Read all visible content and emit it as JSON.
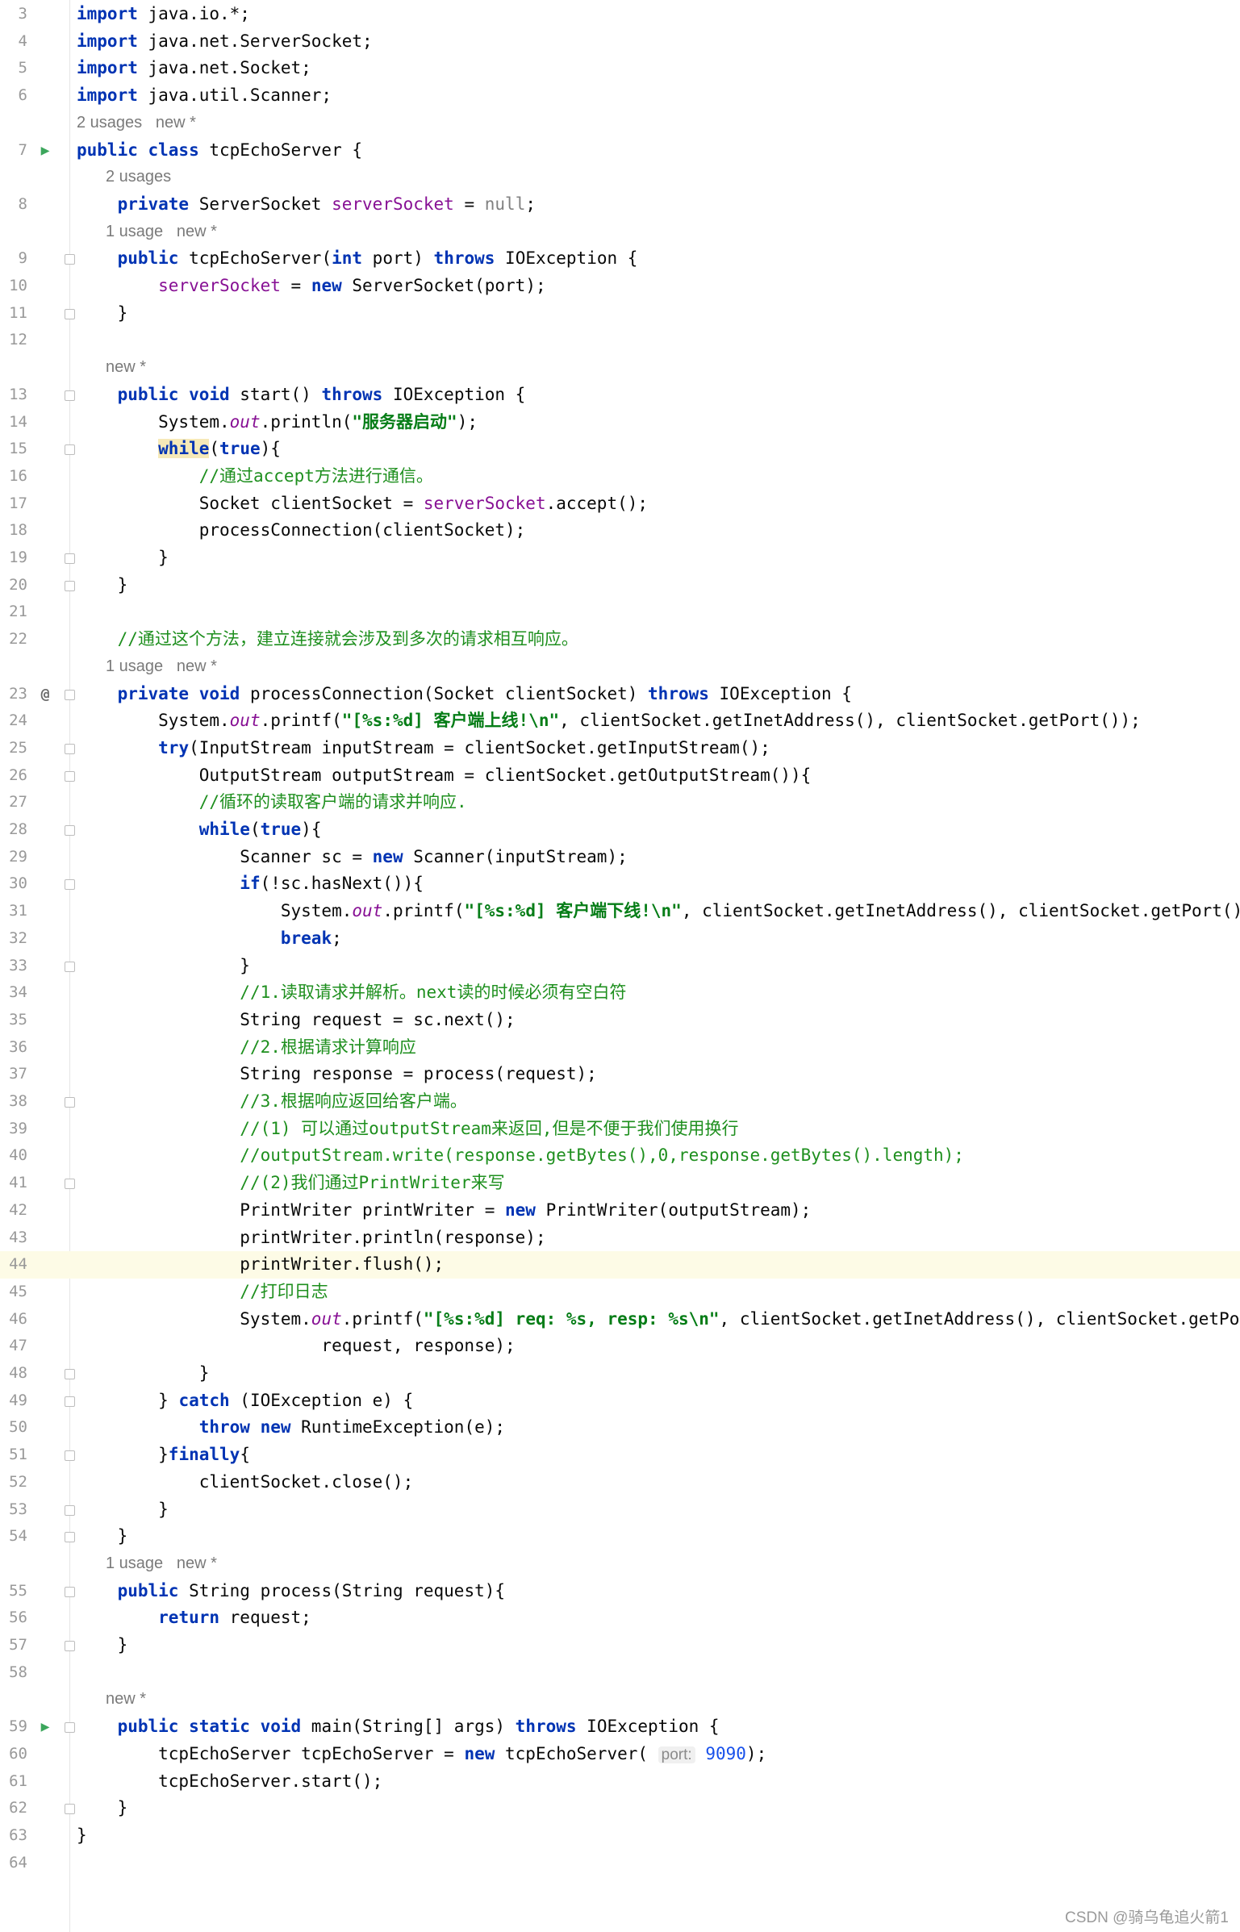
{
  "editor": {
    "lines": [
      {
        "n": "3",
        "parts": [
          [
            "k",
            "import"
          ],
          [
            "t",
            " java.io.*;"
          ]
        ]
      },
      {
        "n": "4",
        "parts": [
          [
            "k",
            "import"
          ],
          [
            "t",
            " java.net.ServerSocket;"
          ]
        ]
      },
      {
        "n": "5",
        "parts": [
          [
            "k",
            "import"
          ],
          [
            "t",
            " java.net.Socket;"
          ]
        ]
      },
      {
        "n": "6",
        "parts": [
          [
            "k",
            "import"
          ],
          [
            "t",
            " java.util.Scanner;"
          ]
        ]
      },
      {
        "meta": "2 usages   new *",
        "ind": 0
      },
      {
        "n": "7",
        "icon": "run",
        "parts": [
          [
            "k",
            "public class"
          ],
          [
            "t",
            " tcpEchoServer {"
          ]
        ]
      },
      {
        "meta": "2 usages",
        "ind": 1
      },
      {
        "n": "8",
        "parts": [
          [
            "t",
            "    "
          ],
          [
            "k",
            "private"
          ],
          [
            "t",
            " ServerSocket "
          ],
          [
            "f",
            "serverSocket"
          ],
          [
            "t",
            " = "
          ],
          [
            "nul",
            "null"
          ],
          [
            "t",
            ";"
          ]
        ]
      },
      {
        "meta": "1 usage   new *",
        "ind": 1
      },
      {
        "n": "9",
        "parts": [
          [
            "t",
            "    "
          ],
          [
            "k",
            "public"
          ],
          [
            "t",
            " tcpEchoServer("
          ],
          [
            "k",
            "int"
          ],
          [
            "t",
            " port) "
          ],
          [
            "k",
            "throws"
          ],
          [
            "t",
            " IOException {"
          ]
        ]
      },
      {
        "n": "10",
        "parts": [
          [
            "t",
            "        "
          ],
          [
            "f",
            "serverSocket"
          ],
          [
            "t",
            " = "
          ],
          [
            "k",
            "new"
          ],
          [
            "t",
            " ServerSocket(port);"
          ]
        ]
      },
      {
        "n": "11",
        "parts": [
          [
            "t",
            "    }"
          ]
        ]
      },
      {
        "n": "12",
        "parts": []
      },
      {
        "meta": "new *",
        "ind": 1
      },
      {
        "n": "13",
        "parts": [
          [
            "t",
            "    "
          ],
          [
            "k",
            "public void"
          ],
          [
            "t",
            " start() "
          ],
          [
            "k",
            "throws"
          ],
          [
            "t",
            " IOException {"
          ]
        ]
      },
      {
        "n": "14",
        "parts": [
          [
            "t",
            "        System."
          ],
          [
            "st",
            "out"
          ],
          [
            "t",
            ".println("
          ],
          [
            "s",
            "\"服务器启动\""
          ],
          [
            "t",
            ");"
          ]
        ]
      },
      {
        "n": "15",
        "parts": [
          [
            "t",
            "        "
          ],
          [
            "kw",
            "while"
          ],
          [
            "t",
            "("
          ],
          [
            "k",
            "true"
          ],
          [
            "t",
            "){"
          ]
        ]
      },
      {
        "n": "16",
        "parts": [
          [
            "t",
            "            "
          ],
          [
            "c",
            "//通过accept方法进行通信。"
          ]
        ]
      },
      {
        "n": "17",
        "parts": [
          [
            "t",
            "            Socket clientSocket = "
          ],
          [
            "f",
            "serverSocket"
          ],
          [
            "t",
            ".accept();"
          ]
        ]
      },
      {
        "n": "18",
        "parts": [
          [
            "t",
            "            processConnection(clientSocket);"
          ]
        ]
      },
      {
        "n": "19",
        "parts": [
          [
            "t",
            "        }"
          ]
        ]
      },
      {
        "n": "20",
        "parts": [
          [
            "t",
            "    }"
          ]
        ]
      },
      {
        "n": "21",
        "parts": []
      },
      {
        "n": "22",
        "parts": [
          [
            "t",
            "    "
          ],
          [
            "c",
            "//通过这个方法，建立连接就会涉及到多次的请求相互响应。"
          ]
        ]
      },
      {
        "meta": "1 usage   new *",
        "ind": 1
      },
      {
        "n": "23",
        "icon": "at",
        "parts": [
          [
            "t",
            "    "
          ],
          [
            "k",
            "private void"
          ],
          [
            "t",
            " processConnection(Socket clientSocket) "
          ],
          [
            "k",
            "throws"
          ],
          [
            "t",
            " IOException {"
          ]
        ]
      },
      {
        "n": "24",
        "parts": [
          [
            "t",
            "        System."
          ],
          [
            "st",
            "out"
          ],
          [
            "t",
            ".printf("
          ],
          [
            "s",
            "\"[%s:%d] 客户端上线!\\n\""
          ],
          [
            "t",
            ", clientSocket.getInetAddress(), clientSocket.getPort());"
          ]
        ]
      },
      {
        "n": "25",
        "parts": [
          [
            "t",
            "        "
          ],
          [
            "k",
            "try"
          ],
          [
            "t",
            "(InputStream inputStream = clientSocket.getInputStream();"
          ]
        ]
      },
      {
        "n": "26",
        "parts": [
          [
            "t",
            "            OutputStream outputStream = clientSocket.getOutputStream()){"
          ]
        ]
      },
      {
        "n": "27",
        "parts": [
          [
            "t",
            "            "
          ],
          [
            "c",
            "//循环的读取客户端的请求并响应."
          ]
        ]
      },
      {
        "n": "28",
        "parts": [
          [
            "t",
            "            "
          ],
          [
            "k",
            "while"
          ],
          [
            "t",
            "("
          ],
          [
            "k",
            "true"
          ],
          [
            "t",
            "){"
          ]
        ]
      },
      {
        "n": "29",
        "parts": [
          [
            "t",
            "                Scanner sc = "
          ],
          [
            "k",
            "new"
          ],
          [
            "t",
            " Scanner(inputStream);"
          ]
        ]
      },
      {
        "n": "30",
        "parts": [
          [
            "t",
            "                "
          ],
          [
            "k",
            "if"
          ],
          [
            "t",
            "(!sc.hasNext()){"
          ]
        ]
      },
      {
        "n": "31",
        "parts": [
          [
            "t",
            "                    System."
          ],
          [
            "st",
            "out"
          ],
          [
            "t",
            ".printf("
          ],
          [
            "s",
            "\"[%s:%d] 客户端下线!\\n\""
          ],
          [
            "t",
            ", clientSocket.getInetAddress(), clientSocket.getPort());"
          ]
        ]
      },
      {
        "n": "32",
        "parts": [
          [
            "t",
            "                    "
          ],
          [
            "k",
            "break"
          ],
          [
            "t",
            ";"
          ]
        ]
      },
      {
        "n": "33",
        "parts": [
          [
            "t",
            "                }"
          ]
        ]
      },
      {
        "n": "34",
        "parts": [
          [
            "t",
            "                "
          ],
          [
            "c",
            "//1.读取请求并解析。next读的时候必须有空白符"
          ]
        ]
      },
      {
        "n": "35",
        "parts": [
          [
            "t",
            "                String request = sc.next();"
          ]
        ]
      },
      {
        "n": "36",
        "parts": [
          [
            "t",
            "                "
          ],
          [
            "c",
            "//2.根据请求计算响应"
          ]
        ]
      },
      {
        "n": "37",
        "parts": [
          [
            "t",
            "                String response = process(request);"
          ]
        ]
      },
      {
        "n": "38",
        "parts": [
          [
            "t",
            "                "
          ],
          [
            "c",
            "//3.根据响应返回给客户端。"
          ]
        ]
      },
      {
        "n": "39",
        "parts": [
          [
            "t",
            "                "
          ],
          [
            "c",
            "//(1) 可以通过outputStream来返回,但是不便于我们使用换行"
          ]
        ]
      },
      {
        "n": "40",
        "parts": [
          [
            "t",
            "                "
          ],
          [
            "c",
            "//outputStream.write(response.getBytes(),0,response.getBytes().length);"
          ]
        ]
      },
      {
        "n": "41",
        "parts": [
          [
            "t",
            "                "
          ],
          [
            "c",
            "//(2)我们通过PrintWriter来写"
          ]
        ]
      },
      {
        "n": "42",
        "parts": [
          [
            "t",
            "                PrintWriter printWriter = "
          ],
          [
            "k",
            "new"
          ],
          [
            "t",
            " PrintWriter(outputStream);"
          ]
        ]
      },
      {
        "n": "43",
        "parts": [
          [
            "t",
            "                printWriter.println(response);"
          ]
        ]
      },
      {
        "n": "44",
        "hl": true,
        "parts": [
          [
            "t",
            "                printWriter.flush();"
          ]
        ]
      },
      {
        "n": "45",
        "parts": [
          [
            "t",
            "                "
          ],
          [
            "c",
            "//打印日志"
          ]
        ]
      },
      {
        "n": "46",
        "parts": [
          [
            "t",
            "                System."
          ],
          [
            "st",
            "out"
          ],
          [
            "t",
            ".printf("
          ],
          [
            "s",
            "\"[%s:%d] req: %s, resp: %s\\n\""
          ],
          [
            "t",
            ", clientSocket.getInetAddress(), clientSocket.getPort(),"
          ]
        ]
      },
      {
        "n": "47",
        "parts": [
          [
            "t",
            "                        request, response);"
          ]
        ]
      },
      {
        "n": "48",
        "parts": [
          [
            "t",
            "            }"
          ]
        ]
      },
      {
        "n": "49",
        "parts": [
          [
            "t",
            "        } "
          ],
          [
            "k",
            "catch"
          ],
          [
            "t",
            " (IOException e) {"
          ]
        ]
      },
      {
        "n": "50",
        "parts": [
          [
            "t",
            "            "
          ],
          [
            "k",
            "throw new"
          ],
          [
            "t",
            " RuntimeException(e);"
          ]
        ]
      },
      {
        "n": "51",
        "parts": [
          [
            "t",
            "        }"
          ],
          [
            "k",
            "finally"
          ],
          [
            "t",
            "{"
          ]
        ]
      },
      {
        "n": "52",
        "parts": [
          [
            "t",
            "            clientSocket.close();"
          ]
        ]
      },
      {
        "n": "53",
        "parts": [
          [
            "t",
            "        }"
          ]
        ]
      },
      {
        "n": "54",
        "parts": [
          [
            "t",
            "    }"
          ]
        ]
      },
      {
        "meta": "1 usage   new *",
        "ind": 1
      },
      {
        "n": "55",
        "parts": [
          [
            "t",
            "    "
          ],
          [
            "k",
            "public"
          ],
          [
            "t",
            " String process(String request){"
          ]
        ]
      },
      {
        "n": "56",
        "parts": [
          [
            "t",
            "        "
          ],
          [
            "k",
            "return"
          ],
          [
            "t",
            " request;"
          ]
        ]
      },
      {
        "n": "57",
        "parts": [
          [
            "t",
            "    }"
          ]
        ]
      },
      {
        "n": "58",
        "parts": []
      },
      {
        "meta": "new *",
        "ind": 1
      },
      {
        "n": "59",
        "icon": "run",
        "parts": [
          [
            "t",
            "    "
          ],
          [
            "k",
            "public static void"
          ],
          [
            "t",
            " main(String[] args) "
          ],
          [
            "k",
            "throws"
          ],
          [
            "t",
            " IOException {"
          ]
        ]
      },
      {
        "n": "60",
        "parts": [
          [
            "t",
            "        tcpEchoServer tcpEchoServer = "
          ],
          [
            "k",
            "new"
          ],
          [
            "t",
            " tcpEchoServer( "
          ],
          [
            "hint",
            "port:"
          ],
          [
            "num",
            " 9090"
          ],
          [
            "t",
            ");"
          ]
        ]
      },
      {
        "n": "61",
        "parts": [
          [
            "t",
            "        tcpEchoServer.start();"
          ]
        ]
      },
      {
        "n": "62",
        "parts": [
          [
            "t",
            "    }"
          ]
        ]
      },
      {
        "n": "63",
        "parts": [
          [
            "t",
            "}"
          ]
        ]
      },
      {
        "n": "64",
        "parts": []
      }
    ]
  },
  "watermark": "CSDN @骑乌龟追火箭1"
}
